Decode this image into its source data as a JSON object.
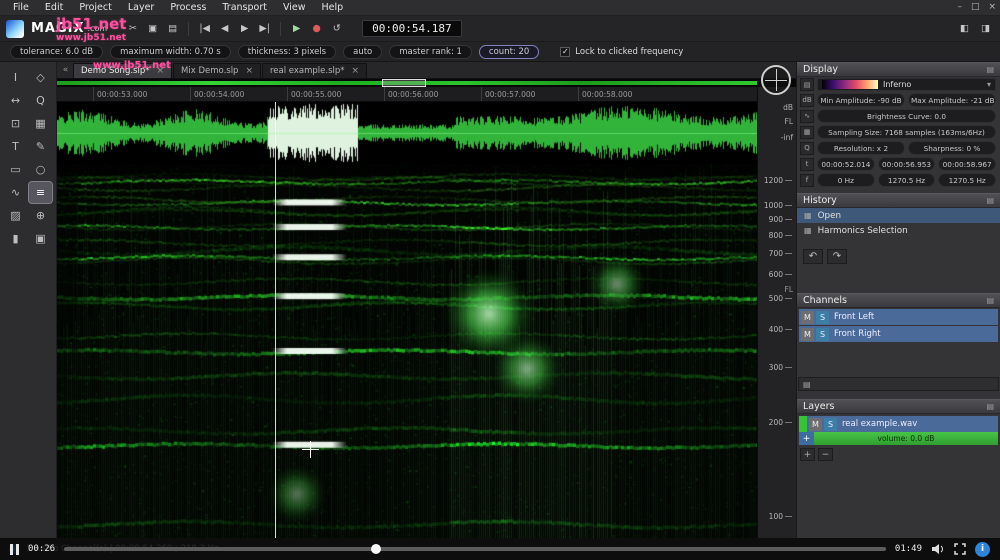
{
  "watermarks": {
    "line1": "jb51.net",
    "line2": "www.jb51.net",
    "tab_mark": "www.jb51.net"
  },
  "icons": {
    "minimize": "–",
    "maximize": "□",
    "close": "×",
    "check": "✓",
    "chevron_down": "▾",
    "collapse": "«",
    "undo": "↶",
    "redo": "↷",
    "menu": "▤",
    "history_item": "▦",
    "plus": "+",
    "minus": "−",
    "info": "i",
    "palette": "▤",
    "db_unit": "dB",
    "curve": "∿",
    "grid": "▦",
    "zoom": "Q",
    "time_unit": "t",
    "freq_unit": "f"
  },
  "menu": {
    "items": [
      "File",
      "Edit",
      "Project",
      "Layer",
      "Process",
      "Transport",
      "View",
      "Help"
    ]
  },
  "toolbar": {
    "logo": "MAGIX",
    "logo_suffix": ".com",
    "time": "00:00:54.187",
    "buttons": [
      {
        "glyph": "✂",
        "name": "cut-icon"
      },
      {
        "glyph": "▣",
        "name": "copy-icon"
      },
      {
        "glyph": "▤",
        "name": "paste-icon"
      },
      {
        "glyph": "",
        "name": "toolbar-separator",
        "cls": "sep"
      },
      {
        "glyph": "|◀",
        "name": "go-to-start-icon"
      },
      {
        "glyph": "◀",
        "name": "step-back-icon"
      },
      {
        "glyph": "▶",
        "name": "step-forward-icon"
      },
      {
        "glyph": "▶|",
        "name": "go-to-end-icon"
      },
      {
        "glyph": "",
        "name": "toolbar-separator",
        "cls": "sep"
      },
      {
        "glyph": "▶",
        "name": "play-icon",
        "cls": "play"
      },
      {
        "glyph": "●",
        "name": "record-icon",
        "cls": "rec"
      },
      {
        "glyph": "↺",
        "name": "loop-icon"
      }
    ],
    "right_buttons": [
      {
        "glyph": "◧",
        "name": "layout-left-icon"
      },
      {
        "glyph": "◨",
        "name": "layout-split-icon"
      }
    ]
  },
  "settings": {
    "fields": [
      {
        "label": "tolerance: 6.0 dB"
      },
      {
        "label": "maximum width: 0.70 s"
      },
      {
        "label": "thickness: 3 pixels"
      },
      {
        "label": "auto"
      },
      {
        "label": "master rank: 1"
      },
      {
        "label": "count: 20",
        "selected": true
      }
    ],
    "lock_label": "Lock to clicked frequency"
  },
  "tabs": [
    {
      "label": "Demo Song.slp*",
      "active": true
    },
    {
      "label": "Mix Demo.slp"
    },
    {
      "label": "real example.slp*"
    }
  ],
  "tools": {
    "items": [
      {
        "glyph": "I",
        "name": "time-select-tool"
      },
      {
        "glyph": "◇",
        "name": "pointer-tool"
      },
      {
        "glyph": "↔",
        "name": "pan-tool"
      },
      {
        "glyph": "Q",
        "name": "zoom-tool"
      },
      {
        "glyph": "⊡",
        "name": "crop-tool"
      },
      {
        "glyph": "▦",
        "name": "transform-tool"
      },
      {
        "glyph": "T",
        "name": "marker-tool"
      },
      {
        "glyph": "✎",
        "name": "draw-tool"
      },
      {
        "glyph": "▭",
        "name": "rect-select-tool"
      },
      {
        "glyph": "○",
        "name": "lasso-select-tool"
      },
      {
        "glyph": "∿",
        "name": "freehand-select-tool"
      },
      {
        "glyph": "≡",
        "name": "harmonics-select-tool",
        "selected": true
      },
      {
        "glyph": "▨",
        "name": "eraser-tool"
      },
      {
        "glyph": "⊕",
        "name": "clone-stamp-tool"
      },
      {
        "glyph": "▮",
        "name": "brush-tool"
      },
      {
        "glyph": "▣",
        "name": "cube-3d-tool"
      }
    ]
  },
  "timeline": {
    "ticks": [
      "00:00:53.000",
      "00:00:54.000",
      "00:00:55.000",
      "00:00:56.000",
      "00:00:57.000",
      "00:00:58.000"
    ]
  },
  "wave_scale": {
    "db": "dB",
    "neg_inf": "-inf",
    "channel": "FL"
  },
  "freq_scale": {
    "labels": [
      "1200",
      "1000",
      "900",
      "800",
      "700",
      "600",
      "500",
      "400",
      "300",
      "200",
      "100"
    ],
    "channel": "FL"
  },
  "display_panel": {
    "title": "Display",
    "colormap": "Inferno",
    "min_amp": "Min Amplitude: -90 dB",
    "max_amp": "Max Amplitude: -21 dB",
    "brightness": "Brightness Curve: 0.0",
    "sampling": "Sampling Size: 7168 samples (163ms/6Hz)",
    "resolution": "Resolution: x 2",
    "sharpness": "Sharpness: 0 %",
    "time_start": "00:00:52.014",
    "time_cursor": "00:00:56.953",
    "time_end": "00:00:58.967",
    "freq_low": "0 Hz",
    "freq_cursor": "1270.5 Hz",
    "freq_high": "1270.5 Hz"
  },
  "history": {
    "title": "History",
    "items": [
      {
        "label": "Open",
        "active": true
      },
      {
        "label": "Harmonics Selection"
      }
    ]
  },
  "channels": {
    "title": "Channels",
    "mute_label": "M",
    "solo_label": "S",
    "items": [
      {
        "name": "Front Left"
      },
      {
        "name": "Front Right"
      }
    ]
  },
  "layers": {
    "title": "Layers",
    "layer_name": "real example.wav",
    "volume_label": "volume: 0.0 dB"
  },
  "statusbar": {
    "text": "1 Audio Channel(s) | 00:00:54.369 ; 218.3 Hz"
  },
  "player": {
    "current": "00:26",
    "duration": "01:49",
    "progress_pct": 38
  }
}
